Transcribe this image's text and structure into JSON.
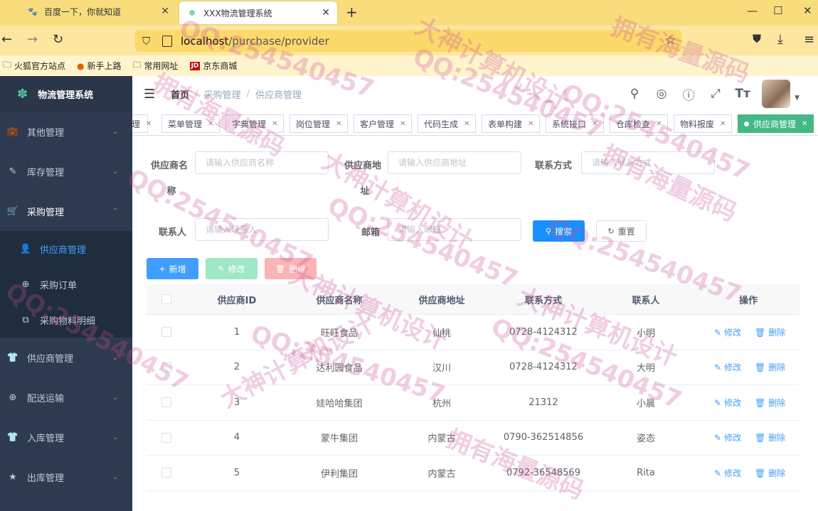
{
  "browser": {
    "tabs": [
      {
        "title": "百度一下，你就知道",
        "icon": "baidu-paw-icon"
      },
      {
        "title": "XXX物流管理系统",
        "icon": "app-leaf-icon"
      }
    ],
    "url_host": "localhost",
    "url_path": "/purchase/provider",
    "bookmarks": [
      "火狐官方站点",
      "新手上路",
      "常用网址",
      "京东商城"
    ]
  },
  "sidebar": {
    "title": "物流管理系统",
    "items": [
      {
        "label": "其他管理",
        "icon": "briefcase-icon"
      },
      {
        "label": "库存管理",
        "icon": "edit-icon"
      },
      {
        "label": "采购管理",
        "icon": "cart-icon"
      },
      {
        "label": "供应商管理",
        "icon": "tshirt-icon"
      },
      {
        "label": "配送运输",
        "icon": "lifebuoy-icon"
      },
      {
        "label": "入库管理",
        "icon": "tshirt-icon"
      },
      {
        "label": "出库管理",
        "icon": "star-icon"
      }
    ],
    "sub_items": [
      {
        "label": "供应商管理",
        "icon": "user-icon"
      },
      {
        "label": "采购订单",
        "icon": "lifebuoy-icon"
      },
      {
        "label": "采购物料明细",
        "icon": "puzzle-icon"
      }
    ]
  },
  "header": {
    "breadcrumb": [
      "首页",
      "采购管理",
      "供应商管理"
    ]
  },
  "tags": [
    "理",
    "菜单管理",
    "字典管理",
    "岗位管理",
    "客户管理",
    "代码生成",
    "表单构建",
    "系统接口",
    "仓库检查",
    "物料报废",
    "供应商管理"
  ],
  "search": {
    "name_label_1": "供应商名",
    "name_label_2": "称",
    "name_placeholder": "请输入供应商名称",
    "addr_label_1": "供应商地",
    "addr_label_2": "址",
    "addr_placeholder": "请输入供应商地址",
    "contact_label": "联系方式",
    "contact_placeholder": "请输入联系方式",
    "person_label": "联系人",
    "person_placeholder": "请输入联系人",
    "email_label": "邮箱",
    "email_placeholder": "请输入邮箱",
    "search_btn": "搜索",
    "reset_btn": "重置"
  },
  "toolbar": {
    "add": "新增",
    "edit": "修改",
    "delete": "删除"
  },
  "table": {
    "columns": [
      "供应商ID",
      "供应商名称",
      "供应商地址",
      "联系方式",
      "联系人",
      "操作"
    ],
    "rows": [
      {
        "id": "1",
        "name": "旺旺食品",
        "addr": "仙桃",
        "phone": "0728-4124312",
        "person": "小明"
      },
      {
        "id": "2",
        "name": "达利园食品",
        "addr": "汉川",
        "phone": "0728-4124312",
        "person": "大明"
      },
      {
        "id": "3",
        "name": "娃哈哈集团",
        "addr": "杭州",
        "phone": "21312",
        "person": "小晨"
      },
      {
        "id": "4",
        "name": "蒙牛集团",
        "addr": "内蒙古",
        "phone": "0790-362514856",
        "person": "姿态"
      },
      {
        "id": "5",
        "name": "伊利集团",
        "addr": "内蒙古",
        "phone": "0792-36548569",
        "person": "Rita"
      }
    ],
    "op_edit": "修改",
    "op_delete": "删除"
  },
  "watermarks": [
    "QQ:254540457",
    "大神计算机设计",
    "拥有海量源码"
  ]
}
